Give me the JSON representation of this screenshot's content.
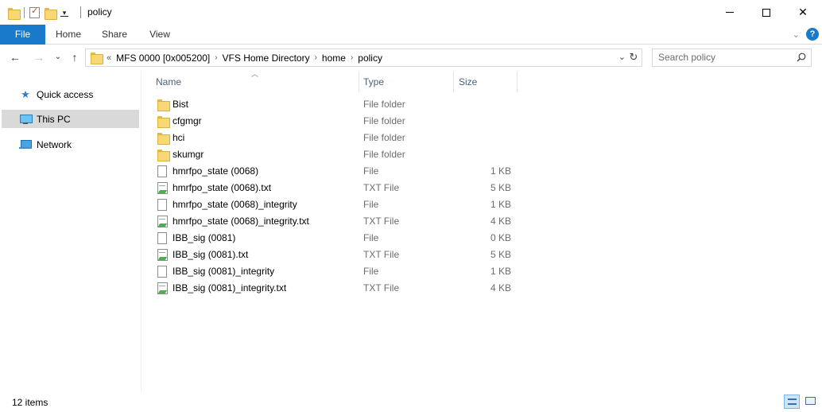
{
  "window": {
    "title": "policy"
  },
  "ribbon": {
    "tabs": [
      "File",
      "Home",
      "Share",
      "View"
    ]
  },
  "address": {
    "overflow": "«",
    "crumbs": [
      "MFS 0000 [0x005200]",
      "VFS Home Directory",
      "home",
      "policy"
    ]
  },
  "search": {
    "placeholder": "Search policy"
  },
  "navpane": {
    "items": [
      {
        "label": "Quick access",
        "icon": "star-icon"
      },
      {
        "label": "This PC",
        "icon": "computer-icon",
        "selected": true
      },
      {
        "label": "Network",
        "icon": "network-icon"
      }
    ]
  },
  "columns": {
    "name": "Name",
    "type": "Type",
    "size": "Size"
  },
  "files": [
    {
      "name": "Bist",
      "type": "File folder",
      "size": "",
      "icon": "folder-icon"
    },
    {
      "name": "cfgmgr",
      "type": "File folder",
      "size": "",
      "icon": "folder-icon"
    },
    {
      "name": "hci",
      "type": "File folder",
      "size": "",
      "icon": "folder-icon"
    },
    {
      "name": "skumgr",
      "type": "File folder",
      "size": "",
      "icon": "folder-icon"
    },
    {
      "name": "hmrfpo_state (0068)",
      "type": "File",
      "size": "1 KB",
      "icon": "file-icon"
    },
    {
      "name": "hmrfpo_state (0068).txt",
      "type": "TXT File",
      "size": "5 KB",
      "icon": "text-file-icon"
    },
    {
      "name": "hmrfpo_state (0068)_integrity",
      "type": "File",
      "size": "1 KB",
      "icon": "file-icon"
    },
    {
      "name": "hmrfpo_state (0068)_integrity.txt",
      "type": "TXT File",
      "size": "4 KB",
      "icon": "text-file-icon"
    },
    {
      "name": "IBB_sig (0081)",
      "type": "File",
      "size": "0 KB",
      "icon": "file-icon"
    },
    {
      "name": "IBB_sig (0081).txt",
      "type": "TXT File",
      "size": "5 KB",
      "icon": "text-file-icon"
    },
    {
      "name": "IBB_sig (0081)_integrity",
      "type": "File",
      "size": "1 KB",
      "icon": "file-icon"
    },
    {
      "name": "IBB_sig (0081)_integrity.txt",
      "type": "TXT File",
      "size": "4 KB",
      "icon": "text-file-icon"
    }
  ],
  "status": {
    "count": "12 items"
  },
  "colors": {
    "file_tab": "#1979ca",
    "selected_nav": "#d9d9d9",
    "header_text": "#4c607a"
  }
}
